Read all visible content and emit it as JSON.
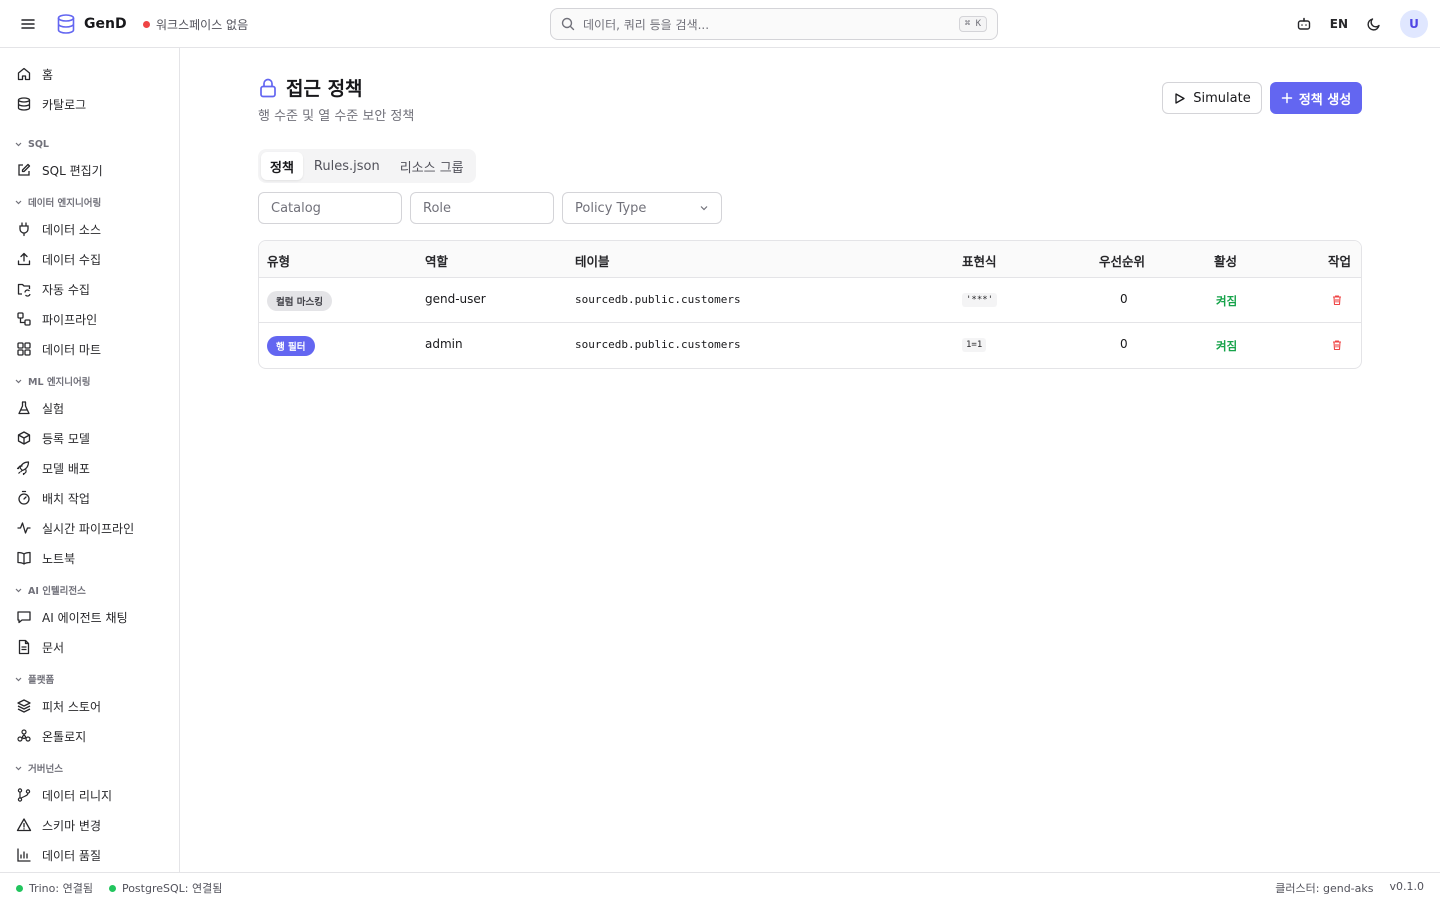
{
  "app": {
    "name": "GenD"
  },
  "workspace": {
    "label": "워크스페이스 없음",
    "status_color": "#ef4444"
  },
  "search": {
    "placeholder": "데이터, 쿼리 등을 검색...",
    "shortcut": "⌘ K"
  },
  "top_right": {
    "lang": "EN",
    "avatar_initial": "U"
  },
  "sidebar": {
    "items_top": [
      {
        "label": "홈",
        "icon": "home-icon"
      },
      {
        "label": "카탈로그",
        "icon": "database-icon"
      }
    ],
    "sections": [
      {
        "title": "SQL",
        "items": [
          {
            "label": "SQL 편집기",
            "icon": "edit-icon"
          }
        ]
      },
      {
        "title": "데이터 엔지니어링",
        "items": [
          {
            "label": "데이터 소스",
            "icon": "plug-icon"
          },
          {
            "label": "데이터 수집",
            "icon": "upload-icon"
          },
          {
            "label": "자동 수집",
            "icon": "folder-sync-icon"
          },
          {
            "label": "파이프라인",
            "icon": "workflow-icon"
          },
          {
            "label": "데이터 마트",
            "icon": "grid-icon"
          }
        ]
      },
      {
        "title": "ML 엔지니어링",
        "items": [
          {
            "label": "실험",
            "icon": "flask-icon"
          },
          {
            "label": "등록 모델",
            "icon": "box-icon"
          },
          {
            "label": "모델 배포",
            "icon": "rocket-icon"
          },
          {
            "label": "배치 작업",
            "icon": "timer-icon"
          },
          {
            "label": "실시간 파이프라인",
            "icon": "activity-icon"
          },
          {
            "label": "노트북",
            "icon": "book-icon"
          }
        ]
      },
      {
        "title": "AI 인텔리전스",
        "items": [
          {
            "label": "AI 에이전트 채팅",
            "icon": "chat-icon"
          },
          {
            "label": "문서",
            "icon": "file-icon"
          }
        ]
      },
      {
        "title": "플랫폼",
        "items": [
          {
            "label": "피처 스토어",
            "icon": "layers-icon"
          },
          {
            "label": "온톨로지",
            "icon": "network-icon"
          }
        ]
      },
      {
        "title": "거버넌스",
        "items": [
          {
            "label": "데이터 리니지",
            "icon": "git-branch-icon"
          },
          {
            "label": "스키마 변경",
            "icon": "alert-triangle-icon"
          },
          {
            "label": "데이터 품질",
            "icon": "bar-chart-icon"
          }
        ]
      }
    ]
  },
  "page": {
    "title": "접근 정책",
    "subtitle": "행 수준 및 열 수준 보안 정책",
    "simulate_label": "Simulate",
    "create_label": "정책 생성"
  },
  "tabs": [
    "정책",
    "Rules.json",
    "리소스 그룹"
  ],
  "filters": {
    "catalog_placeholder": "Catalog",
    "role_placeholder": "Role",
    "policy_type_placeholder": "Policy Type"
  },
  "table": {
    "headers": [
      "유형",
      "역할",
      "테이블",
      "표현식",
      "우선순위",
      "활성",
      "작업"
    ],
    "rows": [
      {
        "type": "컬럼 마스킹",
        "type_style": "gray",
        "role": "gend-user",
        "table": "sourcedb.public.customers",
        "expression": "'***'",
        "priority": "0",
        "active": "켜짐"
      },
      {
        "type": "행 필터",
        "type_style": "indigo",
        "role": "admin",
        "table": "sourcedb.public.customers",
        "expression": "1=1",
        "priority": "0",
        "active": "켜짐"
      }
    ]
  },
  "statusbar": {
    "trino": "Trino: 연결됨",
    "postgres": "PostgreSQL: 연결됨",
    "cluster": "클러스터: gend-aks",
    "version": "v0.1.0",
    "connected_color": "#22c55e"
  },
  "colors": {
    "accent": "#6366f1",
    "active_green": "#16a34a",
    "danger": "#ef4444"
  }
}
